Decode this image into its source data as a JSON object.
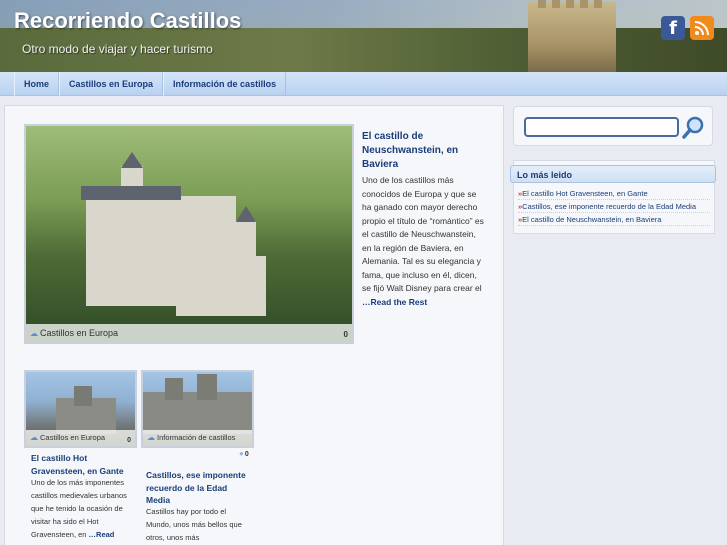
{
  "header": {
    "site_title": "Recorriendo Castillos",
    "tagline": "Otro modo de viajar y hacer turismo",
    "social": [
      {
        "icon": "facebook-icon",
        "glyph": "f",
        "color": "#3b5998"
      },
      {
        "icon": "rss-icon",
        "color": "#f18a1c"
      }
    ]
  },
  "nav": {
    "items": [
      "Home",
      "Castillos en Europa",
      "Información de castillos"
    ]
  },
  "featured": {
    "title": "El castillo de Neuschwanstein, en Baviera",
    "excerpt": "Uno de los castillos más conocidos de Europa y que se ha ganado con mayor derecho propio el título de “romántico” es el castillo de Neuschwanstein, en la región de Baviera, en Alemania. Tal es su elegancia y fama, que incluso en él, dicen, se fijó Walt Disney para crear el",
    "read_more": "…Read the Rest",
    "category": "Castillos en Europa",
    "comments": "0"
  },
  "posts": [
    {
      "category": "Castillos en Europa",
      "comments": "0",
      "title": "El castillo Hot Gravensteen, en Gante",
      "excerpt": "Uno de los más imponentes castillos medievales urbanos que he tenido la ocasión de visitar ha sido el Hot Gravensteen, en",
      "read_more": "…Read"
    },
    {
      "category": "Información de castillos",
      "comments": "0",
      "title": "Castillos, ese imponente recuerdo de la Edad Media",
      "excerpt": "Castillos hay por todo el Mundo, unos más bellos que otros, unos más"
    }
  ],
  "sidebar": {
    "search_placeholder": "",
    "widget_title": "Lo más leido",
    "widget_items": [
      "El castillo Hot Gravensteen, en Gante",
      "Castillos, ese imponente recuerdo de la Edad Media",
      "El castillo de Neuschwanstein, en Baviera"
    ]
  },
  "colors": {
    "link": "#1a3d7a",
    "nav_bg": "#c6dbf4",
    "accent": "#4a6b9a"
  }
}
